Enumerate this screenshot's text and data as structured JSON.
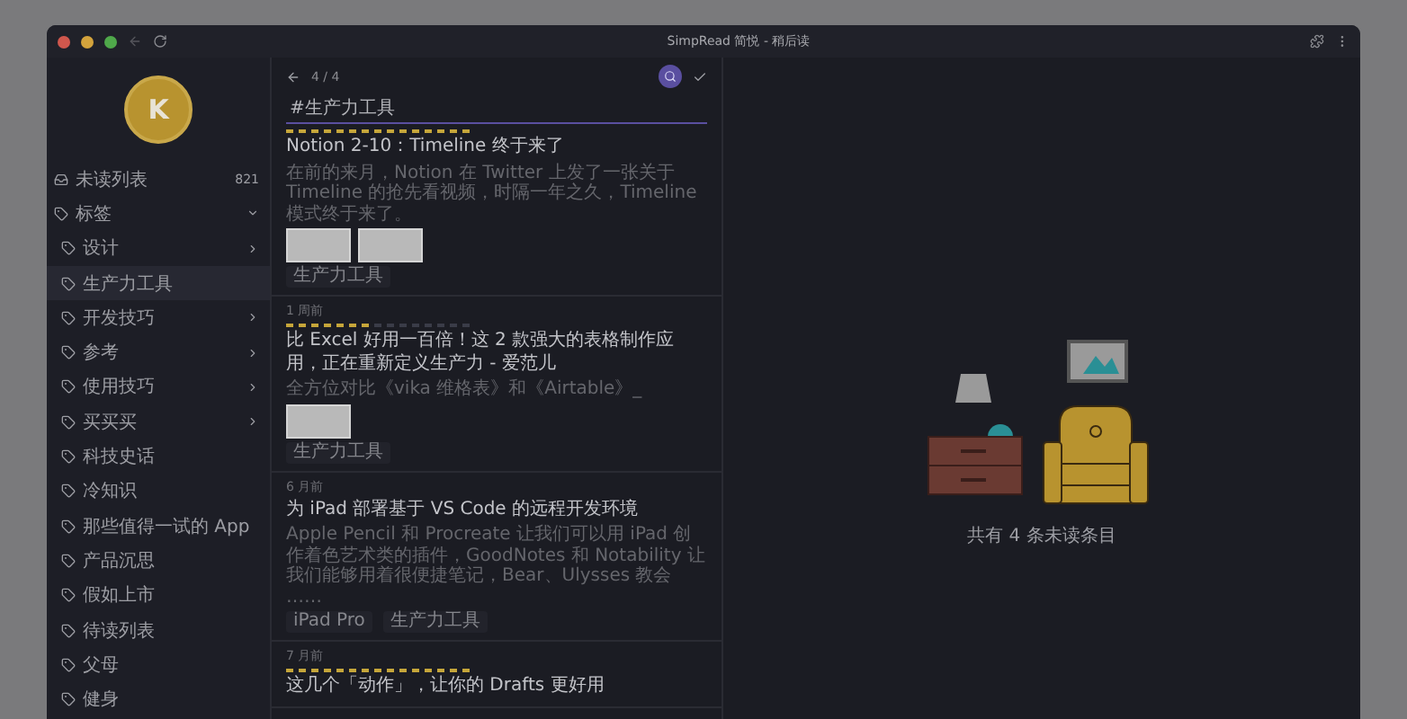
{
  "window": {
    "title": "SimpRead 简悦 - 稍后读"
  },
  "sidebar": {
    "avatar_letter": "K",
    "inbox": {
      "label": "未读列表",
      "count": "821"
    },
    "tags": {
      "label": "标签",
      "expanded": true,
      "children": [
        {
          "label": "设计",
          "selected": false,
          "has_children": true
        },
        {
          "label": "生产力工具",
          "selected": true,
          "has_children": false
        },
        {
          "label": "开发技巧",
          "selected": false,
          "has_children": true
        },
        {
          "label": "参考",
          "selected": false,
          "has_children": true
        },
        {
          "label": "使用技巧",
          "selected": false,
          "has_children": true
        },
        {
          "label": "买买买",
          "selected": false,
          "has_children": true
        },
        {
          "label": "科技史话",
          "selected": false,
          "has_children": false
        },
        {
          "label": "冷知识",
          "selected": false,
          "has_children": false
        },
        {
          "label": "那些值得一试的 App",
          "selected": false,
          "has_children": false
        },
        {
          "label": "产品沉思",
          "selected": false,
          "has_children": false
        },
        {
          "label": "假如上市",
          "selected": false,
          "has_children": false
        },
        {
          "label": "待读列表",
          "selected": false,
          "has_children": false
        },
        {
          "label": "父母",
          "selected": false,
          "has_children": false
        },
        {
          "label": "健身",
          "selected": false,
          "has_children": false
        }
      ]
    }
  },
  "list": {
    "pager": "4 / 4",
    "search": {
      "value": "#生产力工具"
    },
    "cards": [
      {
        "level": 1,
        "title": "Notion 2-10：Timeline 终于来了",
        "excerpt": "在前的来月，Notion 在 Twitter 上发了一张关于 Timeline 的抢先看视频，时隔一年之久，Timeline 模式终于来了。",
        "thumbnails": [
          {
            "kind": "screenshot"
          },
          {
            "kind": "screenshot"
          }
        ],
        "tags": [
          "生产力工具"
        ]
      },
      {
        "date": "1 周前",
        "level": 0.47,
        "title": "比 Excel 好用一百倍！这 2 款强大的表格制作应用，正在重新定义生产力 - 爱范儿",
        "excerpt": "全方位对比《vika 维格表》和《Airtable》_",
        "thumbnails": [
          {
            "kind": "screenshot"
          }
        ],
        "tags": [
          "生产力工具"
        ]
      },
      {
        "date": "6 月前",
        "title": "为 iPad 部署基于 VS Code 的远程开发环境",
        "excerpt": "Apple Pencil 和 Procreate 让我们可以用 iPad 创作着色艺术类的插件，GoodNotes 和 Notability 让我们能够用着很便捷笔记，Bear、Ulysses 教会 ……",
        "tags": [
          "iPad Pro",
          "生产力工具"
        ]
      },
      {
        "date": "7 月前",
        "level": 1,
        "title": "这几个「动作」，让你的 Drafts 更好用"
      }
    ]
  },
  "empty_state": {
    "message": "共有 4 条未读条目"
  }
}
